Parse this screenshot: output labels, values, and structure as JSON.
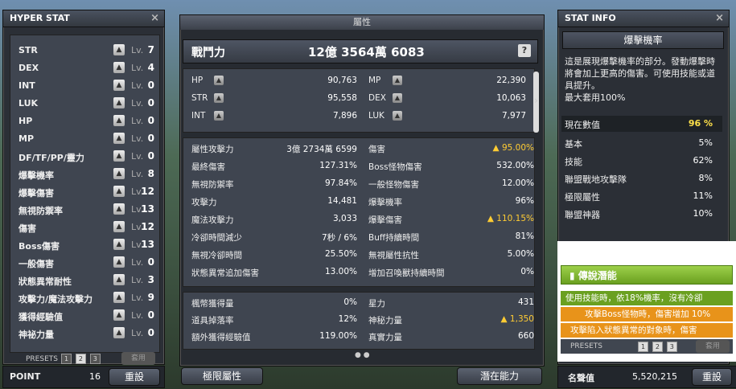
{
  "hyper_stat": {
    "title": "HYPER STAT",
    "close": "×",
    "rows": [
      {
        "name": "STR",
        "lv": "Lv.",
        "val": "7"
      },
      {
        "name": "DEX",
        "lv": "Lv.",
        "val": "4"
      },
      {
        "name": "INT",
        "lv": "Lv.",
        "val": "0"
      },
      {
        "name": "LUK",
        "lv": "Lv.",
        "val": "0"
      },
      {
        "name": "HP",
        "lv": "Lv.",
        "val": "0"
      },
      {
        "name": "MP",
        "lv": "Lv.",
        "val": "0"
      },
      {
        "name": "DF/TF/PP/靈力",
        "lv": "Lv.",
        "val": "0"
      },
      {
        "name": "爆擊機率",
        "lv": "Lv.",
        "val": "8"
      },
      {
        "name": "爆擊傷害",
        "lv": "Lv.",
        "val": "12"
      },
      {
        "name": "無視防禦率",
        "lv": "Lv.",
        "val": "13"
      },
      {
        "name": "傷害",
        "lv": "Lv.",
        "val": "12"
      },
      {
        "name": "Boss傷害",
        "lv": "Lv.",
        "val": "13"
      },
      {
        "name": "一般傷害",
        "lv": "Lv.",
        "val": "0"
      },
      {
        "name": "狀態異常耐性",
        "lv": "Lv.",
        "val": "3"
      },
      {
        "name": "攻擊力/魔法攻擊力",
        "lv": "Lv.",
        "val": "9"
      },
      {
        "name": "獲得經驗值",
        "lv": "Lv.",
        "val": "0"
      },
      {
        "name": "神祕力量",
        "lv": "Lv.",
        "val": "0"
      }
    ],
    "presets_label": "PRESETS",
    "preset_1": "1",
    "preset_2": "2",
    "preset_3": "3",
    "apply": "套用",
    "point_label": "POINT",
    "point_value": "16",
    "reset": "重設"
  },
  "main": {
    "title": "屬性",
    "power_label": "戰鬥力",
    "power_value": "12億 3564萬 6083",
    "help": "?",
    "basic": [
      {
        "l": "HP",
        "v": "90,763",
        "l2": "MP",
        "v2": "22,390"
      },
      {
        "l": "STR",
        "v": "95,558",
        "l2": "DEX",
        "v2": "10,063"
      },
      {
        "l": "INT",
        "v": "7,896",
        "l2": "LUK",
        "v2": "7,977"
      }
    ],
    "detail": [
      {
        "l": "屬性攻擊力",
        "v": "3億 2734萬 6599",
        "l2": "傷害",
        "v2": "▲ 95.00%",
        "y2": true
      },
      {
        "l": "最終傷害",
        "v": "127.31%",
        "l2": "Boss怪物傷害",
        "v2": "532.00%"
      },
      {
        "l": "無視防禦率",
        "v": "97.84%",
        "l2": "一般怪物傷害",
        "v2": "12.00%"
      },
      {
        "l": "攻擊力",
        "v": "14,481",
        "l2": "爆擊機率",
        "v2": "96%"
      },
      {
        "l": "魔法攻擊力",
        "v": "3,033",
        "l2": "爆擊傷害",
        "v2": "▲ 110.15%",
        "y2": true
      },
      {
        "l": "冷卻時間減少",
        "v": "7秒 / 6%",
        "l2": "Buff持續時間",
        "v2": "81%"
      },
      {
        "l": "無視冷卻時間",
        "v": "25.50%",
        "l2": "無視屬性抗性",
        "v2": "5.00%"
      },
      {
        "l": "狀態異常追加傷害",
        "v": "13.00%",
        "l2": "增加召喚獸持續時間",
        "v2": "0%"
      }
    ],
    "extra": [
      {
        "l": "楓幣獲得量",
        "v": "0%",
        "l2": "星力",
        "v2": "431"
      },
      {
        "l": "道具掉落率",
        "v": "12%",
        "l2": "神秘力量",
        "v2": "▲ 1,350",
        "y2": true
      },
      {
        "l": "額外獲得經驗值",
        "v": "119.00%",
        "l2": "真實力量",
        "v2": "660"
      }
    ],
    "page_dots": "● ●",
    "limit_btn": "極限屬性",
    "potential_btn": "潛在能力"
  },
  "stat_info": {
    "title": "STAT INFO",
    "close": "×",
    "header": "爆擊機率",
    "desc": "這是展現爆擊機率的部分。發動爆擊時將會加上更高的傷害。可使用技能或道具提升。\n最大套用100%",
    "current_label": "現在數值",
    "current_value": "96 %",
    "rows": [
      {
        "a": "基本",
        "b": "5%"
      },
      {
        "a": "技能",
        "b": "62%"
      },
      {
        "a": "聯盟戰地攻擊隊",
        "b": "8%"
      },
      {
        "a": "極限屬性",
        "b": "11%"
      },
      {
        "a": "聯盟神器",
        "b": "10%"
      }
    ]
  },
  "ability": {
    "title": "傳說潛能",
    "lines": [
      "使用技能時，依18%機率，沒有冷卻",
      "攻擊Boss怪物時，傷害增加 10%",
      "攻擊陷入狀態異常的對象時，傷害"
    ],
    "presets_label": "PRESETS",
    "p1": "1",
    "p2": "2",
    "p3": "3",
    "apply": "套用",
    "fame_label": "名聲值",
    "fame_value": "5,520,215",
    "reset": "重設"
  }
}
